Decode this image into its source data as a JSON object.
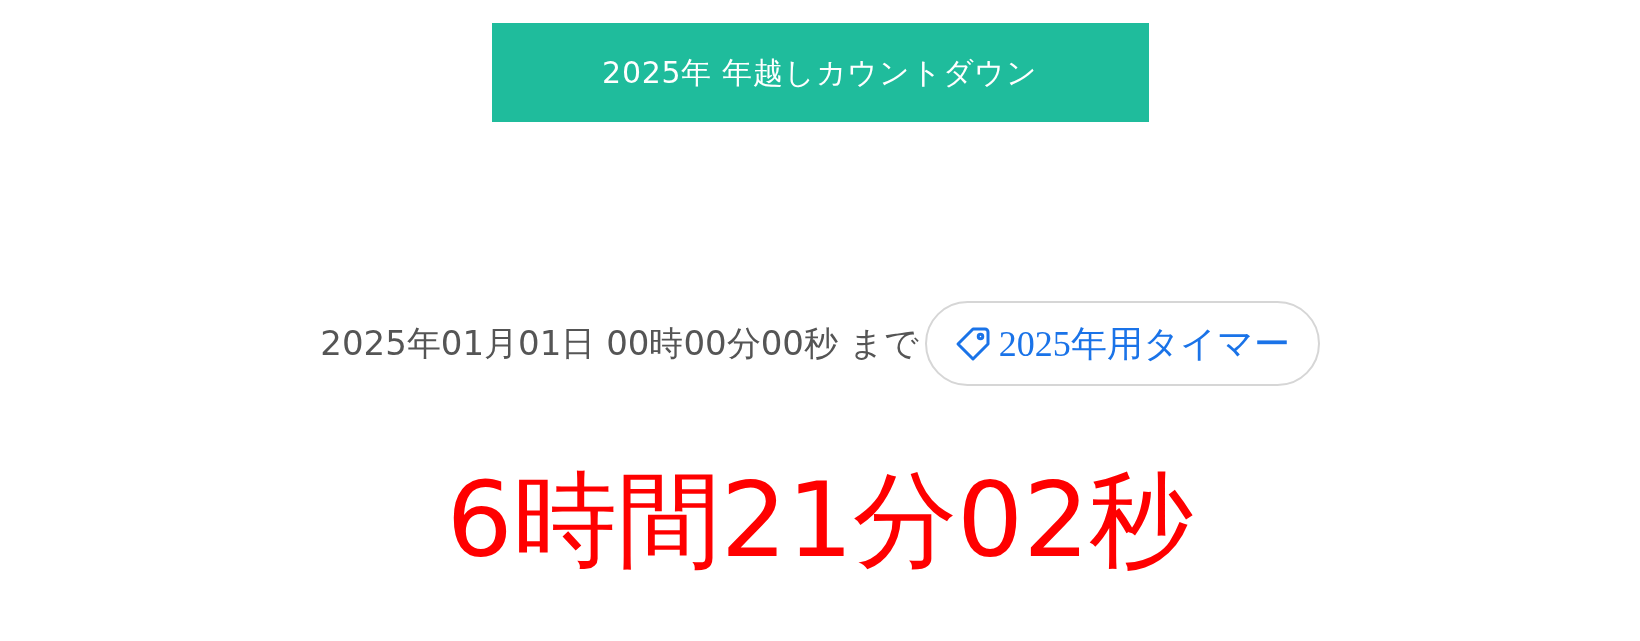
{
  "banner": {
    "title": "2025年 年越しカウントダウン"
  },
  "target": {
    "text": "2025年01月01日 00時00分00秒 まで",
    "tag": "2025年用タイマー"
  },
  "countdown": "6時間21分02秒"
}
